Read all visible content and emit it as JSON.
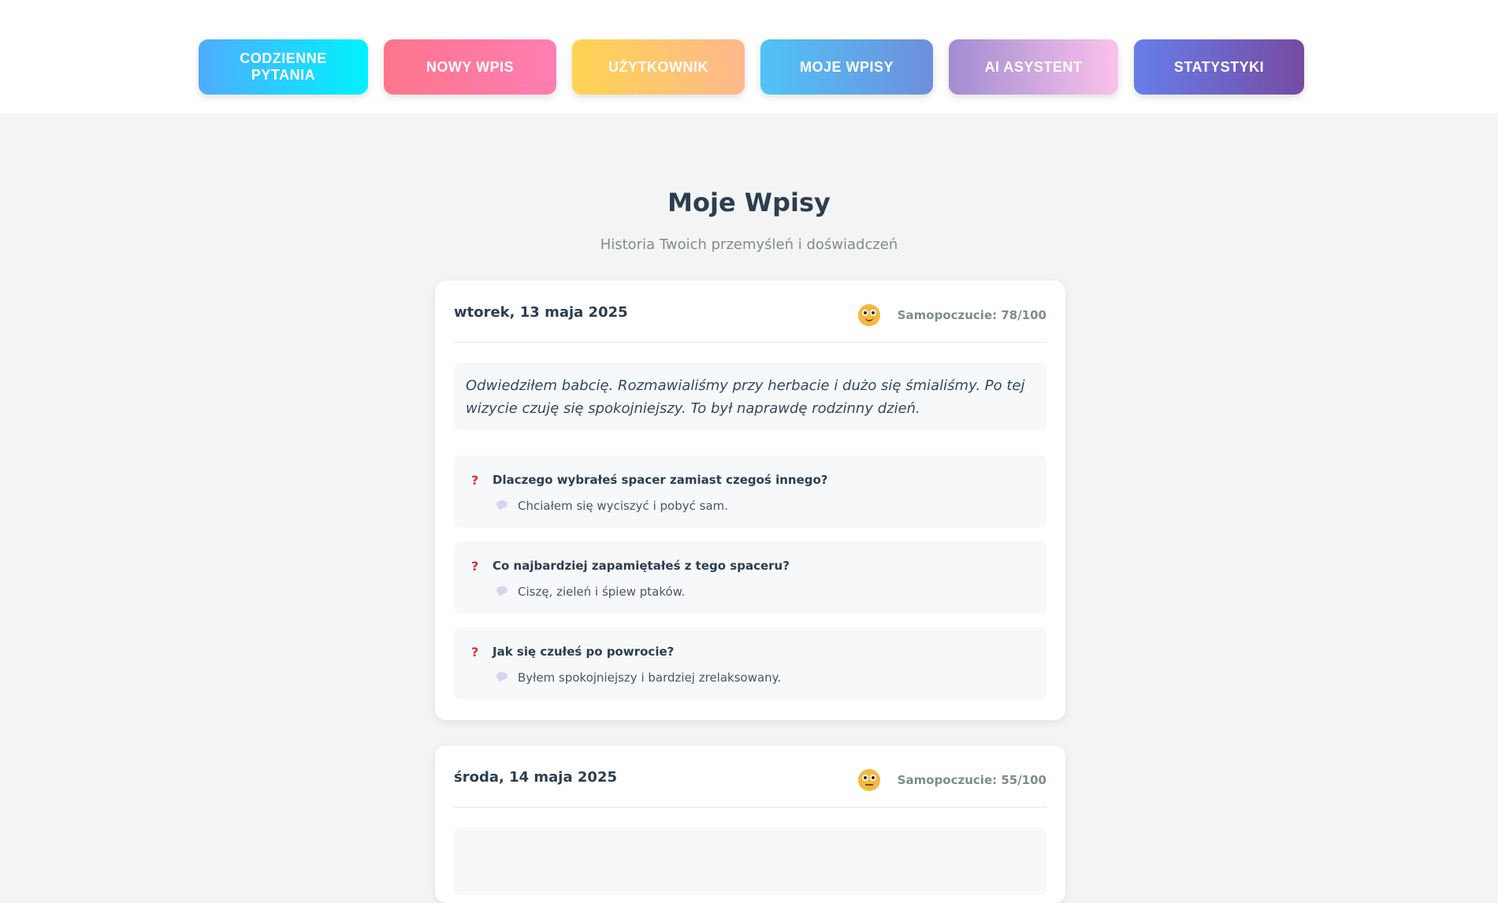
{
  "nav": {
    "items": [
      {
        "line1": "CODZIENNE",
        "line2": "PYTANIA"
      },
      {
        "line1": "NOWY WPIS",
        "line2": ""
      },
      {
        "line1": "UŻYTKOWNIK",
        "line2": ""
      },
      {
        "line1": "MOJE WPISY",
        "line2": ""
      },
      {
        "line1": "AI ASYSTENT",
        "line2": ""
      },
      {
        "line1": "STATYSTYKI",
        "line2": ""
      }
    ]
  },
  "main": {
    "title": "Moje Wpisy",
    "subtitle": "Historia Twoich przemyśleń i doświadczeń"
  },
  "entries": [
    {
      "date": "wtorek, 13 maja 2025",
      "mood": "Samopoczucie: 78/100",
      "content": "Odwiedziłem babcię. Rozmawialiśmy przy herbacie i dużo się śmialiśmy. Po tej wizycie czuję się spokojniejszy. To był naprawdę rodzinny dzień.",
      "qa": [
        {
          "q": "Dlaczego wybrałeś spacer zamiast czegoś innego?",
          "a": "Chciałem się wyciszyć i pobyć sam."
        },
        {
          "q": "Co najbardziej zapamiętałeś z tego spaceru?",
          "a": "Ciszę, zieleń i śpiew ptaków."
        },
        {
          "q": "Jak się czułeś po powrocie?",
          "a": "Byłem spokojniejszy i bardziej zrelaksowany."
        }
      ]
    },
    {
      "date": "środa, 14 maja 2025",
      "mood": "Samopoczucie: 55/100"
    }
  ]
}
